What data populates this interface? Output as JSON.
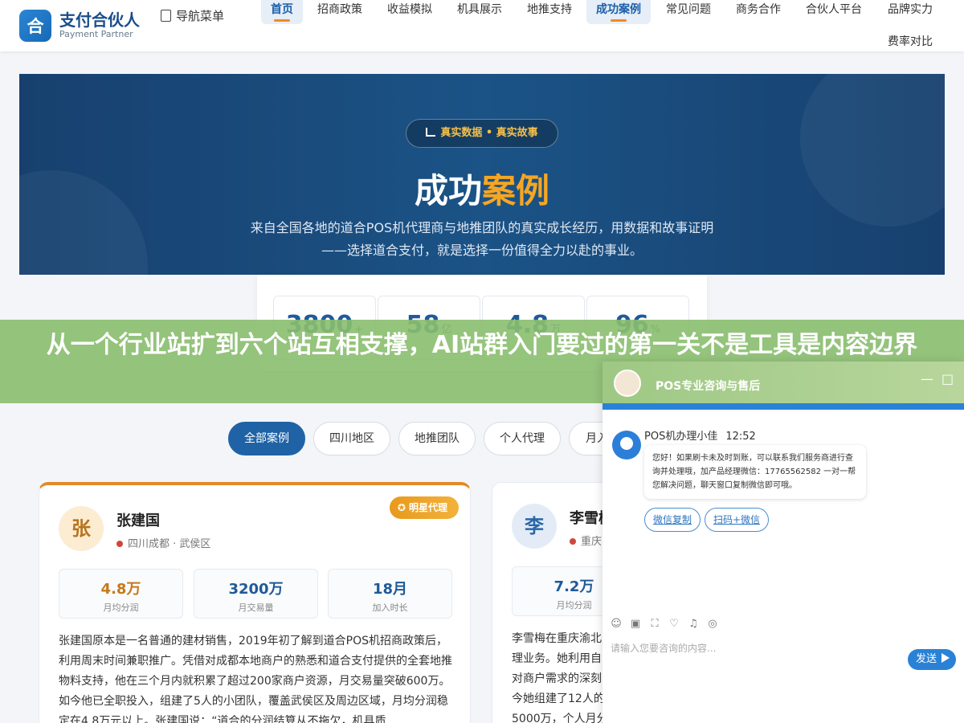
{
  "logo": {
    "mark": "合",
    "title": "支付合伙人",
    "subtitle": "Payment Partner"
  },
  "nav_menu_label": "导航菜单",
  "nav": [
    {
      "label": "首页",
      "active": true
    },
    {
      "label": "招商政策",
      "active": false
    },
    {
      "label": "收益模拟",
      "active": false
    },
    {
      "label": "机具展示",
      "active": false
    },
    {
      "label": "地推支持",
      "active": false
    },
    {
      "label": "成功案例",
      "active": true
    },
    {
      "label": "常见问题",
      "active": false
    },
    {
      "label": "商务合作",
      "active": false
    },
    {
      "label": "合伙人平台",
      "active": false
    },
    {
      "label": "品牌实力",
      "active": false
    },
    {
      "label": "费率对比",
      "active": false
    }
  ],
  "hero": {
    "badge": "真实数据 • 真实故事",
    "title_main": "成功",
    "title_highlight": "案例",
    "description": "来自全国各地的道合POS机代理商与地推团队的真实成长经历，用数据和故事证明——选择道合支付，就是选择一份值得全力以赴的事业。"
  },
  "stats": [
    {
      "value": "3800",
      "unit": "+"
    },
    {
      "value": "58",
      "unit": "亿"
    },
    {
      "value": "4.8",
      "unit": "万"
    },
    {
      "value": "96",
      "unit": "%"
    }
  ],
  "overlay_title": "从一个行业站扩到六个站互相支撑，AI站群入门要过的第一关不是工具是内容边界",
  "filters": [
    {
      "label": "全部案例",
      "active": true
    },
    {
      "label": "四川地区",
      "active": false
    },
    {
      "label": "地推团队",
      "active": false
    },
    {
      "label": "个人代理",
      "active": false
    },
    {
      "label": "月入",
      "active": false
    }
  ],
  "cases": [
    {
      "initial": "张",
      "name": "张建国",
      "location": "四川成都 · 武侯区",
      "badge": "明星代理",
      "metrics": [
        {
          "value": "4.8万",
          "label": "月均分润",
          "color": "#c7781a"
        },
        {
          "value": "3200万",
          "label": "月交易量",
          "color": "#1f5a99"
        },
        {
          "value": "18月",
          "label": "加入时长",
          "color": "#1f5a99"
        }
      ],
      "story": "张建国原本是一名普通的建材销售，2019年初了解到道合POS机招商政策后，利用周末时间兼职推广。凭借对成都本地商户的熟悉和道合支付提供的全套地推物料支持，他在三个月内就积累了超过200家商户资源，月交易量突破600万。如今他已全职投入，组建了5人的小团队，覆盖武侯区及周边区域，月均分润稳定在4.8万元以上。张建国说：“道合的分润结算从不拖欠，机具质"
    },
    {
      "initial": "李",
      "name": "李雪梅",
      "location": "重庆",
      "metrics": [
        {
          "value": "7.2万",
          "label": "月均分润",
          "color": "#1f5a99"
        }
      ],
      "story": "李雪梅在重庆渝北理业务。她利用自对商户需求的深刻今她组建了12人的5000万，个人月分"
    }
  ],
  "chat": {
    "title": "POS专业咨询与售后",
    "agent": "POS机办理小佳",
    "time": "12:52",
    "message": "您好！如果刷卡未及时到账，可以联系我们服务商进行查询并处理哦，加产品经理微信：17765562582 一对一帮您解决问题，聊天窗口复制微信即可哦。",
    "quick_replies": [
      "微信复制",
      "扫码+微信"
    ],
    "input_placeholder": "请输入您要咨询的内容...",
    "send_label": "发送",
    "tool_icons": [
      "emoji-icon",
      "image-icon",
      "screenshot-icon",
      "rating-icon",
      "voice-icon",
      "more-icon"
    ]
  }
}
